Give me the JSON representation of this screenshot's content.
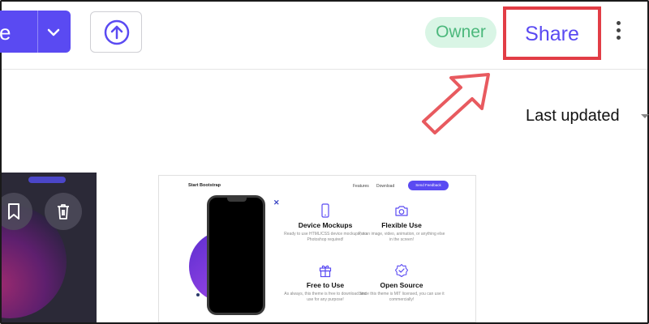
{
  "header": {
    "main_button_label": "e",
    "owner_badge": "Owner",
    "share_label": "Share",
    "last_updated_label": "Last updated"
  },
  "preview": {
    "brand": "Start Bootstrap",
    "nav": [
      "Features",
      "Download"
    ],
    "feedback_button": "Send Feedback",
    "features": [
      {
        "title": "Device Mockups",
        "desc": "Ready to use HTML/CSS device mockups, no Photoshop required!",
        "icon": "phone-icon"
      },
      {
        "title": "Flexible Use",
        "desc": "Put an image, video, animation, or anything else in the screen!",
        "icon": "camera-icon"
      },
      {
        "title": "Free to Use",
        "desc": "As always, this theme is free to download and use for any purpose!",
        "icon": "gift-icon"
      },
      {
        "title": "Open Source",
        "desc": "Since this theme is MIT licensed, you can use it commercially!",
        "icon": "badge-check-icon"
      }
    ]
  },
  "colors": {
    "primary": "#5a4af2",
    "owner_bg": "#d9f5e5",
    "owner_text": "#4cb87c",
    "highlight": "#e23d46"
  }
}
